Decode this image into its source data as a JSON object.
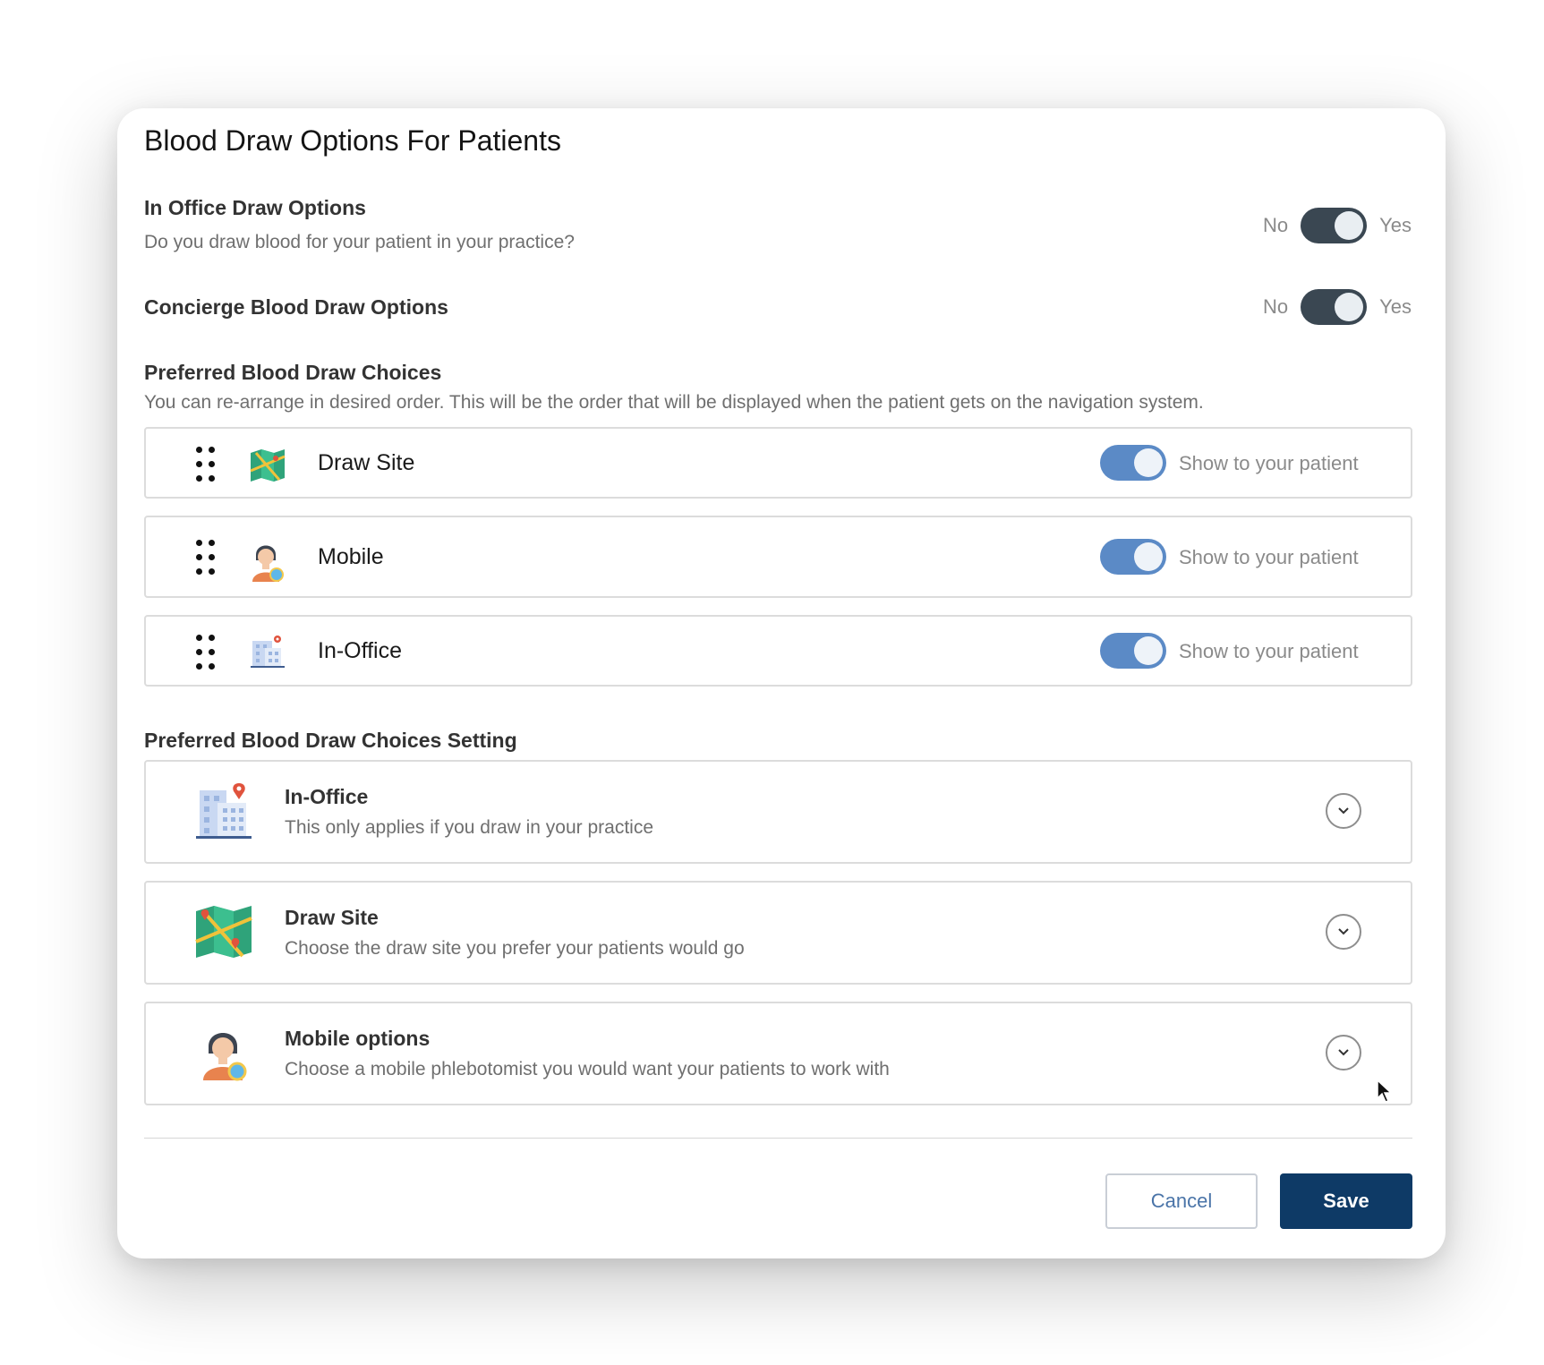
{
  "dialog": {
    "title": "Blood Draw Options For Patients"
  },
  "in_office": {
    "title": "In Office Draw Options",
    "description": "Do you draw blood for your patient in your practice?",
    "no_label": "No",
    "yes_label": "Yes",
    "value": "Yes"
  },
  "concierge": {
    "title": "Concierge Blood Draw Options",
    "no_label": "No",
    "yes_label": "Yes",
    "value": "Yes"
  },
  "preferred": {
    "title": "Preferred Blood Draw Choices",
    "description": "You can re-arrange in desired order. This will be the order that will be displayed when the patient gets on the navigation system.",
    "items": [
      {
        "label": "Draw Site",
        "icon": "map-icon",
        "toggle_label": "Show to your patient",
        "enabled": true
      },
      {
        "label": "Mobile",
        "icon": "phlebotomist-icon",
        "toggle_label": "Show to your patient",
        "enabled": true
      },
      {
        "label": "In-Office",
        "icon": "building-icon",
        "toggle_label": "Show to your patient",
        "enabled": true
      }
    ]
  },
  "settings": {
    "title": "Preferred Blood Draw Choices Setting",
    "items": [
      {
        "title": "In-Office",
        "description": "This only applies if you draw in your practice",
        "icon": "building-icon"
      },
      {
        "title": "Draw Site",
        "description": "Choose the draw site you prefer your patients would go",
        "icon": "map-icon"
      },
      {
        "title": "Mobile options",
        "description": "Choose a mobile phlebotomist you would want your patients to work with",
        "icon": "phlebotomist-icon"
      }
    ]
  },
  "footer": {
    "cancel_label": "Cancel",
    "save_label": "Save"
  },
  "colors": {
    "primary": "#0e3a66",
    "toggle_on": "#5b8ac6",
    "toggle_dark": "#3a4752"
  }
}
